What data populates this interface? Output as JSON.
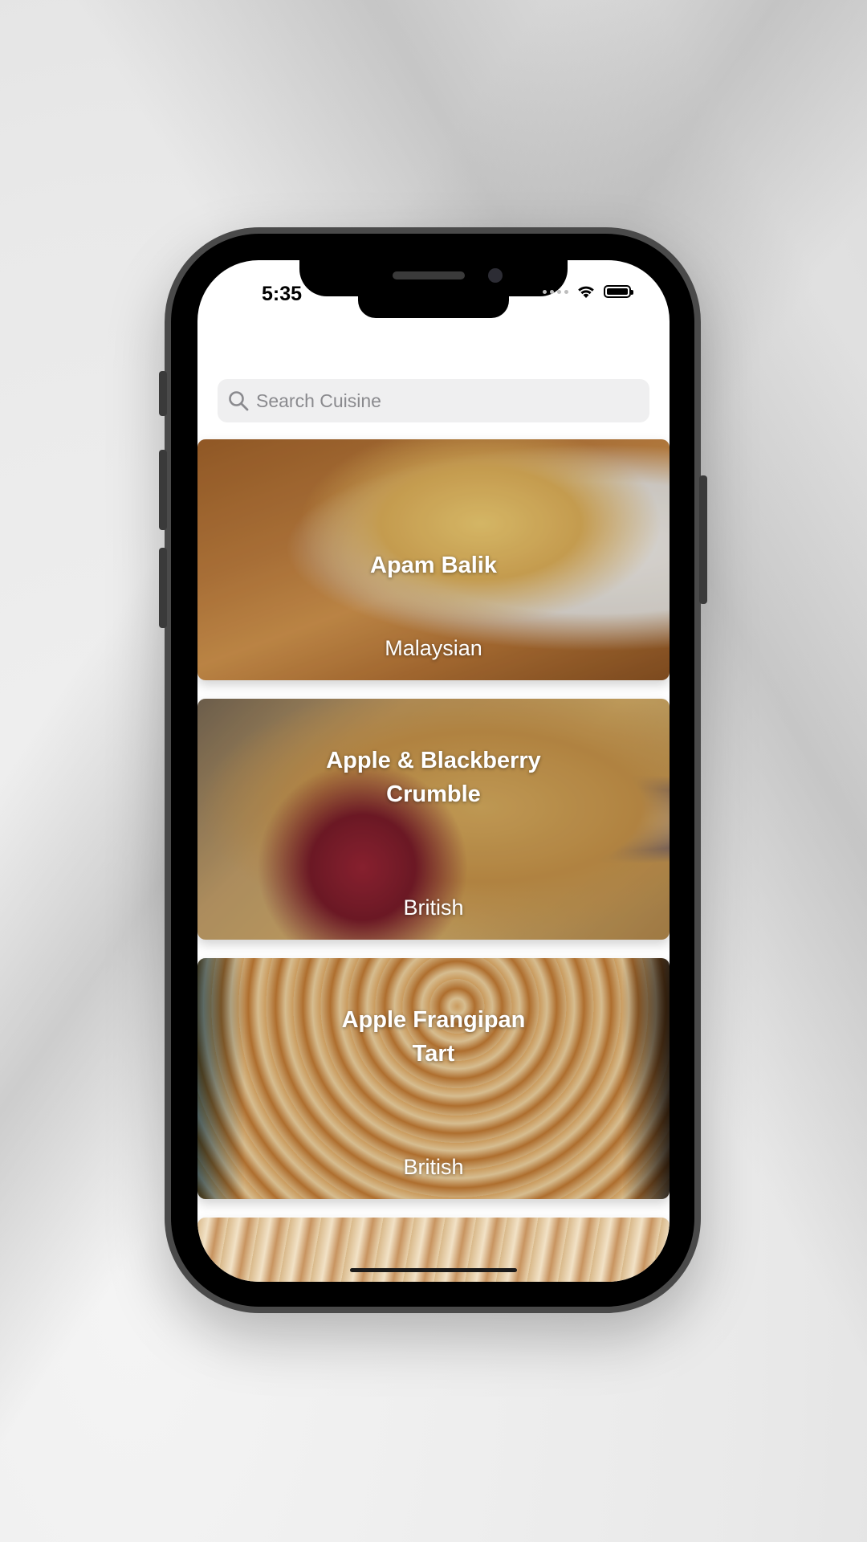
{
  "status_bar": {
    "time": "5:35",
    "icons": [
      "signal-dots-icon",
      "wifi-icon",
      "battery-icon"
    ]
  },
  "search": {
    "placeholder": "Search Cuisine",
    "value": "",
    "icon": "search-icon"
  },
  "meals": [
    {
      "title": "Apam Balik",
      "cuisine": "Malaysian"
    },
    {
      "title": "Apple & Blackberry Crumble",
      "cuisine": "British"
    },
    {
      "title": "Apple Frangipan Tart",
      "cuisine": "British"
    }
  ],
  "colors": {
    "search_bg": "#efeff0",
    "placeholder": "#8a8a8e",
    "card_text": "#ffffff"
  }
}
